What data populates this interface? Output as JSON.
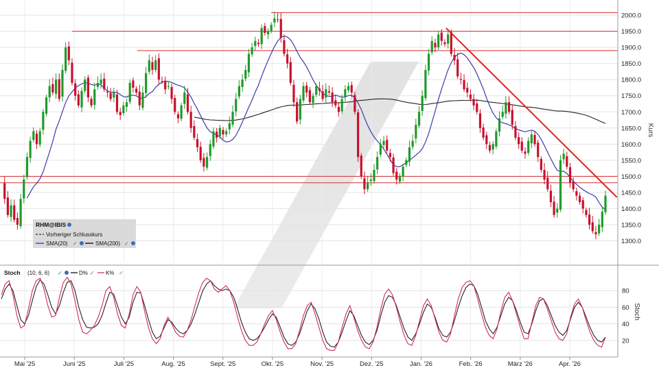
{
  "chart_data": [
    {
      "type": "candlestick",
      "instrument": "RHM@IBIS",
      "legend": {
        "title": "RHM@IBIS",
        "items": [
          "Vorheriger Schlusskurs",
          "SMA(20)",
          "SMA(200)"
        ],
        "placement": "bottom-left"
      },
      "ylabel": "Kurs",
      "ylim": [
        1250,
        2030
      ],
      "yticks": [
        "2000.0",
        "1950.0",
        "1900.0",
        "1850.0",
        "1800.0",
        "1750.0",
        "1700.0",
        "1650.0",
        "1600.0",
        "1550.0",
        "1500.0",
        "1450.0",
        "1400.0",
        "1350.0",
        "1300.0"
      ],
      "xticks": [
        "Mai '25",
        "Juni '25",
        "Juli '25",
        "Aug. '25",
        "Sept. '25",
        "Okt. '25",
        "Nov. '25",
        "Dez. '25",
        "Jan. '26",
        "Feb. '26",
        "März '26",
        "Apr. '26"
      ],
      "grid": true,
      "horizontal_levels": [
        2008,
        1950,
        1890,
        1500,
        1480
      ],
      "trendline": {
        "from": {
          "date": "2026-01-15",
          "value": 1960
        },
        "to": {
          "date": "2026-04-30",
          "value": 1435
        }
      },
      "close": [
        1480,
        1430,
        1380,
        1410,
        1365,
        1350,
        1430,
        1490,
        1560,
        1610,
        1640,
        1600,
        1640,
        1700,
        1745,
        1780,
        1760,
        1800,
        1740,
        1830,
        1900,
        1860,
        1790,
        1750,
        1720,
        1765,
        1800,
        1745,
        1720,
        1770,
        1790,
        1800,
        1770,
        1760,
        1740,
        1760,
        1700,
        1690,
        1720,
        1730,
        1790,
        1775,
        1760,
        1720,
        1760,
        1820,
        1860,
        1830,
        1860,
        1800,
        1795,
        1770,
        1780,
        1740,
        1700,
        1680,
        1720,
        1760,
        1700,
        1650,
        1620,
        1590,
        1550,
        1530,
        1560,
        1600,
        1640,
        1620,
        1650,
        1630,
        1640,
        1665,
        1700,
        1740,
        1780,
        1800,
        1830,
        1880,
        1900,
        1920,
        1910,
        1960,
        1945,
        1950,
        1970,
        1990,
        1985,
        1930,
        1880,
        1850,
        1790,
        1730,
        1670,
        1740,
        1780,
        1760,
        1730,
        1750,
        1780,
        1765,
        1740,
        1770,
        1760,
        1730,
        1720,
        1700,
        1740,
        1770,
        1780,
        1760,
        1700,
        1560,
        1500,
        1460,
        1480,
        1490,
        1520,
        1560,
        1600,
        1610,
        1580,
        1560,
        1510,
        1490,
        1500,
        1530,
        1550,
        1590,
        1610,
        1660,
        1700,
        1750,
        1830,
        1880,
        1920,
        1900,
        1940,
        1920,
        1910,
        1940,
        1880,
        1860,
        1810,
        1800,
        1770,
        1760,
        1740,
        1720,
        1700,
        1650,
        1620,
        1600,
        1580,
        1600,
        1640,
        1680,
        1700,
        1730,
        1700,
        1660,
        1620,
        1600,
        1580,
        1570,
        1610,
        1630,
        1600,
        1560,
        1520,
        1490,
        1460,
        1420,
        1380,
        1400,
        1550,
        1570,
        1530,
        1480,
        1460,
        1440,
        1420,
        1400,
        1380,
        1350,
        1330,
        1320,
        1350,
        1390,
        1440
      ]
    },
    {
      "type": "line",
      "title": "Stoch",
      "parameters": "(10, 6, 6)",
      "legend": {
        "items": [
          "D%",
          "K%"
        ],
        "placement": "top-left"
      },
      "ylabel": "Stoch",
      "ylim": [
        5,
        100
      ],
      "yticks": [
        "80",
        "60",
        "40",
        "20"
      ],
      "grid": true,
      "series": [
        {
          "name": "D%",
          "values": [
            70,
            82,
            88,
            80,
            62,
            45,
            40,
            50,
            68,
            85,
            93,
            88,
            75,
            60,
            52,
            62,
            78,
            90,
            92,
            80,
            60,
            45,
            36,
            35,
            36,
            40,
            50,
            65,
            78,
            76,
            62,
            48,
            40,
            48,
            66,
            78,
            77,
            62,
            45,
            30,
            22,
            25,
            35,
            45,
            42,
            35,
            30,
            28,
            32,
            40,
            52,
            66,
            80,
            88,
            92,
            86,
            82,
            80,
            82,
            80,
            72,
            58,
            42,
            30,
            22,
            20,
            22,
            28,
            36,
            45,
            52,
            48,
            36,
            24,
            16,
            14,
            18,
            28,
            42,
            56,
            64,
            58,
            46,
            30,
            18,
            13,
            12,
            18,
            30,
            44,
            56,
            50,
            38,
            26,
            18,
            15,
            20,
            32,
            50,
            66,
            74,
            72,
            62,
            48,
            34,
            24,
            20,
            28,
            40,
            54,
            64,
            60,
            48,
            34,
            26,
            24,
            30,
            44,
            60,
            74,
            84,
            88,
            86,
            76,
            60,
            44,
            34,
            28,
            36,
            50,
            64,
            72,
            68,
            56,
            42,
            30,
            28,
            40,
            56,
            68,
            70,
            62,
            50,
            38,
            30,
            26,
            32,
            46,
            60,
            66,
            60,
            48,
            36,
            26,
            20,
            18,
            24
          ]
        },
        {
          "name": "K%",
          "values": [
            75,
            88,
            92,
            75,
            50,
            35,
            38,
            58,
            80,
            92,
            95,
            82,
            62,
            48,
            50,
            72,
            90,
            96,
            88,
            68,
            45,
            30,
            28,
            32,
            38,
            48,
            62,
            80,
            85,
            72,
            52,
            38,
            35,
            52,
            75,
            85,
            78,
            55,
            35,
            22,
            16,
            22,
            38,
            48,
            40,
            30,
            25,
            24,
            32,
            45,
            62,
            78,
            90,
            95,
            92,
            82,
            78,
            82,
            86,
            80,
            66,
            48,
            32,
            20,
            14,
            14,
            18,
            28,
            40,
            50,
            56,
            45,
            30,
            18,
            10,
            10,
            16,
            32,
            50,
            62,
            66,
            52,
            36,
            20,
            10,
            8,
            8,
            18,
            36,
            52,
            62,
            48,
            32,
            20,
            12,
            10,
            18,
            36,
            58,
            76,
            82,
            75,
            60,
            42,
            26,
            16,
            14,
            26,
            44,
            62,
            70,
            62,
            46,
            30,
            20,
            18,
            28,
            50,
            70,
            84,
            90,
            92,
            86,
            70,
            52,
            36,
            26,
            22,
            34,
            55,
            72,
            78,
            68,
            52,
            36,
            22,
            22,
            42,
            62,
            72,
            70,
            58,
            44,
            30,
            22,
            20,
            28,
            48,
            64,
            70,
            60,
            44,
            30,
            20,
            14,
            12,
            24
          ]
        }
      ]
    }
  ]
}
